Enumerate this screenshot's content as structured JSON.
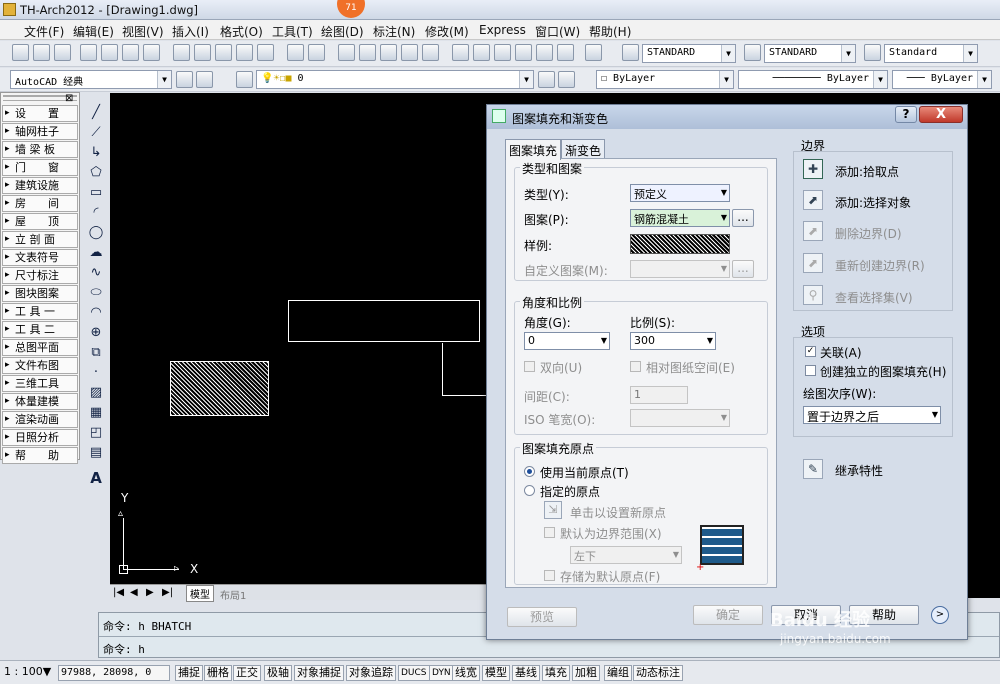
{
  "window": {
    "title": "TH-Arch2012 - [Drawing1.dwg]",
    "badge": "71"
  },
  "menu": [
    "文件(F)",
    "编辑(E)",
    "视图(V)",
    "插入(I)",
    "格式(O)",
    "工具(T)",
    "绘图(D)",
    "标注(N)",
    "修改(M)",
    "Express",
    "窗口(W)",
    "帮助(H)"
  ],
  "toolbar": {
    "text_style": "STANDARD",
    "dim_style": "STANDARD",
    "table_style": "Standard",
    "workspace": "AutoCAD 经典",
    "layer": "0",
    "color": "ByLayer",
    "linetype": "ByLayer",
    "lineweight": "ByLayer"
  },
  "sidebar": {
    "items": [
      "设　　置",
      "轴网柱子",
      "墙 梁 板",
      "门　　窗",
      "建筑设施",
      "房　　间",
      "屋　　顶",
      "立 剖 面",
      "文表符号",
      "尺寸标注",
      "图块图案",
      "工 具 一",
      "工 具 二",
      "总图平面",
      "文件布图",
      "三维工具",
      "体量建模",
      "渲染动画",
      "日照分析",
      "帮　　助"
    ]
  },
  "canvas": {
    "ucs_x": "X",
    "ucs_y": "Y",
    "tabs": [
      "模型",
      "布局1"
    ]
  },
  "command": {
    "line1": "命令: h BHATCH",
    "line2": "命令: h"
  },
  "status": {
    "scale": "1 : 100▼",
    "coords": "97988, 28098, 0",
    "toggles": [
      "捕捉",
      "栅格",
      "正交",
      "极轴",
      "对象捕捉",
      "对象追踪",
      "DUCS",
      "DYN",
      "线宽",
      "模型",
      "基线",
      "填充",
      "加粗",
      "编组",
      "动态标注"
    ]
  },
  "dialog": {
    "title": "图案填充和渐变色",
    "help": "?",
    "close": "X",
    "tabs": [
      "图案填充",
      "渐变色"
    ],
    "type_group": {
      "title": "类型和图案",
      "type_label": "类型(Y):",
      "type_value": "预定义",
      "pattern_label": "图案(P):",
      "pattern_value": "钢筋混凝土",
      "sample_label": "样例:",
      "custom_label": "自定义图案(M):",
      "dots": "..."
    },
    "angle_group": {
      "title": "角度和比例",
      "angle_label": "角度(G):",
      "angle_value": "0",
      "scale_label": "比例(S):",
      "scale_value": "300",
      "double_label": "双向(U)",
      "relative_label": "相对图纸空间(E)",
      "spacing_label": "间距(C):",
      "spacing_value": "1",
      "iso_label": "ISO 笔宽(O):"
    },
    "origin_group": {
      "title": "图案填充原点",
      "use_current": "使用当前原点(T)",
      "specify": "指定的原点",
      "click_set": "单击以设置新原点",
      "default_extent": "默认为边界范围(X)",
      "position": "左下",
      "store_default": "存储为默认原点(F)"
    },
    "boundary": {
      "title": "边界",
      "add_pick": "添加:拾取点",
      "add_select": "添加:选择对象",
      "remove": "删除边界(D)",
      "recreate": "重新创建边界(R)",
      "view": "查看选择集(V)"
    },
    "options": {
      "title": "选项",
      "associative": "关联(A)",
      "independent": "创建独立的图案填充(H)",
      "draw_order_label": "绘图次序(W):",
      "draw_order_value": "置于边界之后",
      "inherit": "继承特性"
    },
    "buttons": {
      "preview": "预览",
      "ok": "确定",
      "cancel": "取消",
      "help": "帮助"
    }
  },
  "watermark": {
    "brand": "Baidu 经验",
    "url": "jingyan.baidu.com"
  }
}
